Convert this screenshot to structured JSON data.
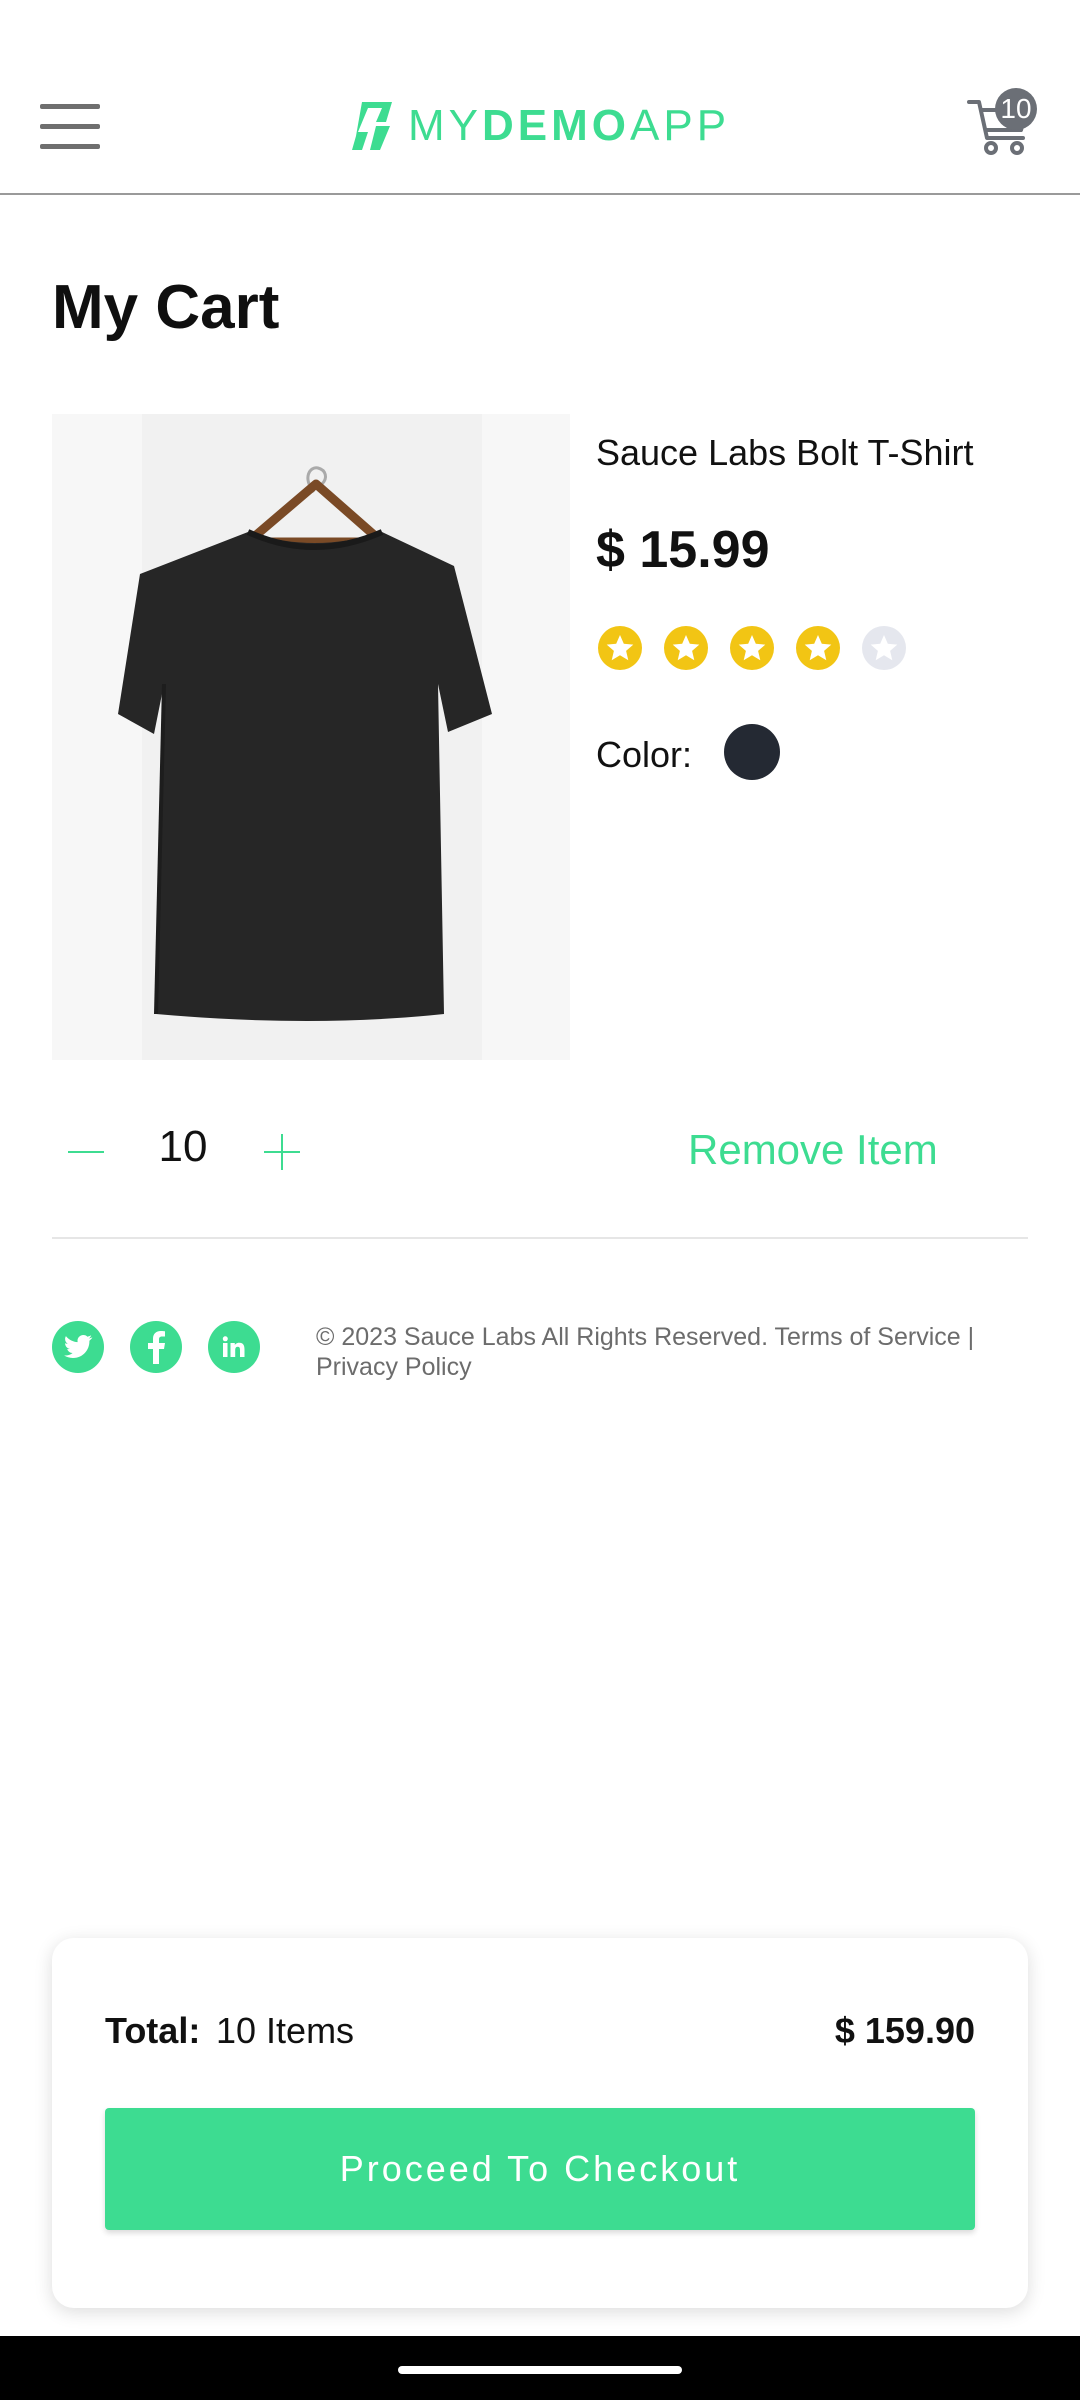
{
  "header": {
    "logo_prefix": "MY",
    "logo_bold": "DEMO",
    "logo_suffix": "APP",
    "cart_count": "10",
    "icons": {
      "menu": "hamburger-menu-icon",
      "cart": "cart-icon",
      "logo": "sauce-logo-icon"
    }
  },
  "page": {
    "title": "My Cart"
  },
  "cart_item": {
    "name": "Sauce Labs Bolt T-Shirt",
    "price": "$ 15.99",
    "rating": {
      "value": 4,
      "max": 5
    },
    "color_label": "Color:",
    "color_hex": "#242933",
    "quantity": "10",
    "remove_label": "Remove Item"
  },
  "footer": {
    "social": [
      "twitter-icon",
      "facebook-icon",
      "linkedin-icon"
    ],
    "copyright": "© 2023 Sauce Labs All Rights Reserved. Terms of Service | Privacy Policy"
  },
  "summary": {
    "total_label": "Total:",
    "items": "10 Items",
    "total_price": "$ 159.90",
    "checkout_label": "Proceed To Checkout"
  },
  "colors": {
    "accent": "#3ddc91",
    "star": "#f2c514",
    "star_empty": "#e5e7ee"
  }
}
